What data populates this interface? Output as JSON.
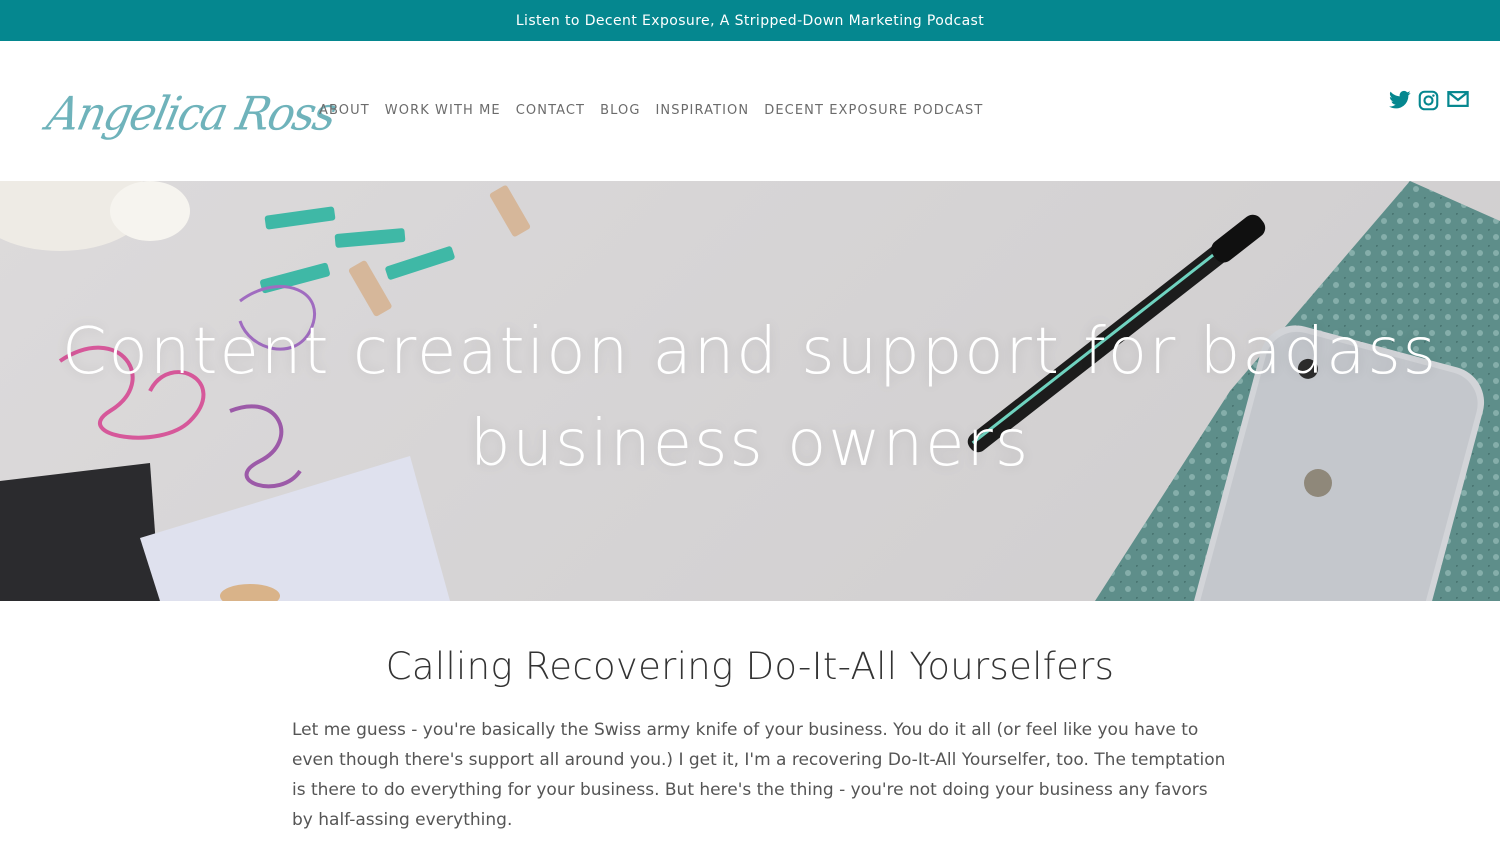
{
  "announcement": {
    "text": "Listen to Decent Exposure, A Stripped-Down Marketing Podcast"
  },
  "header": {
    "logo_text": "Angelica Ross",
    "nav": [
      {
        "label": "ABOUT"
      },
      {
        "label": "WORK WITH ME"
      },
      {
        "label": "CONTACT"
      },
      {
        "label": "BLOG"
      },
      {
        "label": "INSPIRATION"
      },
      {
        "label": "DECENT EXPOSURE PODCAST"
      }
    ],
    "social": [
      {
        "icon": "twitter-icon"
      },
      {
        "icon": "instagram-icon"
      },
      {
        "icon": "email-icon"
      }
    ]
  },
  "hero": {
    "title": "Content creation and support for badass business owners"
  },
  "section": {
    "heading": "Calling Recovering Do-It-All Yourselfers",
    "body": "Let me guess - you're basically the Swiss army knife of your business. You do it all (or feel like you have to even though there's support all around you.)  I get it, I'm a recovering Do-It-All Yourselfer, too. The temptation is there to do everything for your business. But here's the thing - you're not doing your business any favors by half-assing everything."
  },
  "colors": {
    "accent": "#05878f",
    "logo": "#6fb3bb",
    "nav_text": "#6b6b6b"
  }
}
